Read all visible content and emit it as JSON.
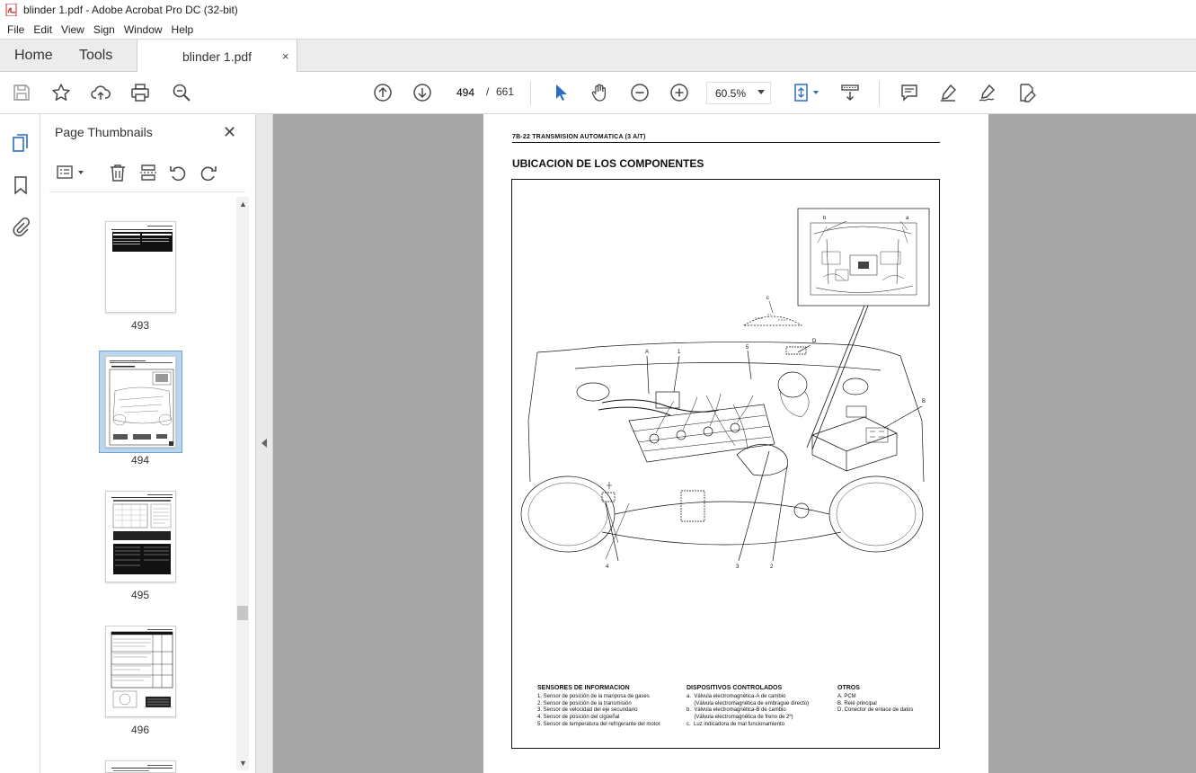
{
  "window": {
    "title": "blinder 1.pdf - Adobe Acrobat Pro DC (32-bit)"
  },
  "menu": [
    "File",
    "Edit",
    "View",
    "Sign",
    "Window",
    "Help"
  ],
  "tabs": {
    "home": "Home",
    "tools": "Tools",
    "document": "blinder 1.pdf",
    "close": "×"
  },
  "toolbar": {
    "current_page": "494",
    "page_separator": "/",
    "total_pages": "661",
    "zoom": "60.5%"
  },
  "sidebar": {
    "panel_title": "Page Thumbnails",
    "thumbnails": [
      {
        "label": "493",
        "selected": false
      },
      {
        "label": "494",
        "selected": true
      },
      {
        "label": "495",
        "selected": false
      },
      {
        "label": "496",
        "selected": false
      }
    ]
  },
  "page": {
    "header": "7B-22   TRANSMISION AUTOMATICA (3 A/T)",
    "section_title": "UBICACION DE LOS COMPONENTES",
    "callouts": [
      "a",
      "b",
      "c",
      "A",
      "1",
      "5",
      "D",
      "B",
      "4",
      "3",
      "2"
    ],
    "legend": {
      "sensors": {
        "heading": "SENSORES DE INFORMACION",
        "items": [
          "1.  Sensor de posición de la mariposa de gases",
          "2.  Sensor de posición de la transmisión",
          "3.  Sensor de velocidad del eje secundario",
          "4.  Sensor de posición del cigüeñal",
          "5.  Sensor de temperatura del refrigerante del motor"
        ]
      },
      "devices": {
        "heading": "DISPOSITIVOS CONTROLADOS",
        "items": [
          "a.  Válvula electromagnética-A de cambio",
          "     (Válvula electromagnética de embrague directo)",
          "b.  Válvula electromagnética-B de cambio",
          "     (Válvula electromagnética de freno de 2ª)",
          "c.  Luz indicadora de mal funcionamiento"
        ]
      },
      "others": {
        "heading": "OTROS",
        "items": [
          "A.  PCM",
          "B.  Relé principal",
          "D.  Conector de enlace de datos"
        ]
      }
    }
  },
  "colors": {
    "accent_blue": "#2b6cc4",
    "toolbar_icon": "#4a4a4a",
    "doc_background": "#a6a6a6",
    "selected_thumb": "#bcd6ee"
  }
}
